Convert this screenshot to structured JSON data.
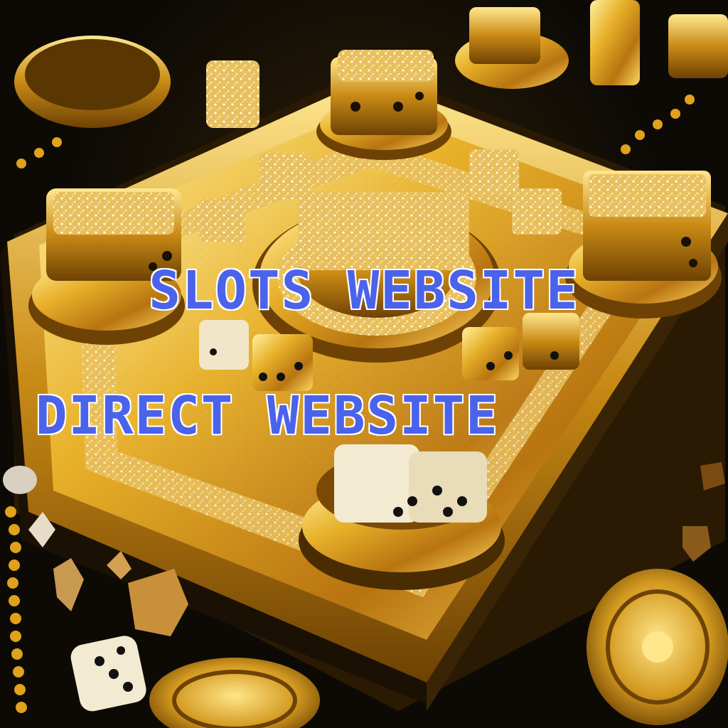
{
  "image": {
    "description_elements": [
      "gold-game-board",
      "jeweled-dice",
      "gold-coins",
      "gold-chain"
    ]
  },
  "overlay": {
    "line1": "SLOTS WEBSITE",
    "line2": "DIRECT WEBSITE",
    "text_color": "#4a63ea",
    "outline_color": "#ffffff"
  },
  "colors": {
    "background": "#0d0a06",
    "gold_light": "#ffe27a",
    "gold_mid": "#e0a21a",
    "gold_dark": "#7a4a05",
    "dice_ivory": "#f3ead2"
  }
}
